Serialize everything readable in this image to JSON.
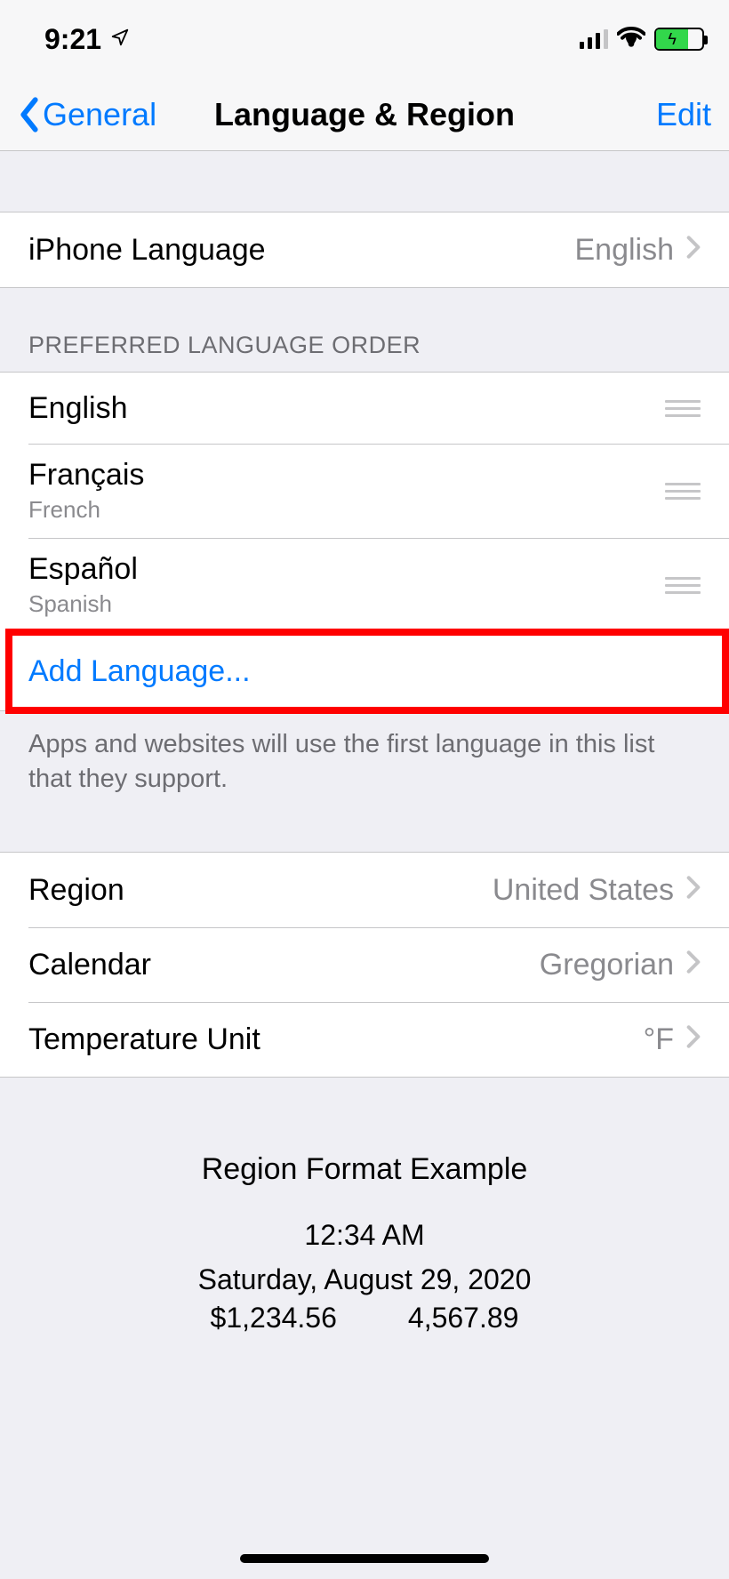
{
  "status": {
    "time": "9:21"
  },
  "nav": {
    "back_label": "General",
    "title": "Language & Region",
    "edit_label": "Edit"
  },
  "iphone_language": {
    "label": "iPhone Language",
    "value": "English"
  },
  "preferred_header": "PREFERRED LANGUAGE ORDER",
  "languages": [
    {
      "name": "English",
      "sub": ""
    },
    {
      "name": "Français",
      "sub": "French"
    },
    {
      "name": "Español",
      "sub": "Spanish"
    }
  ],
  "add_language_label": "Add Language...",
  "preferred_footer": "Apps and websites will use the first language in this list that they support.",
  "region_settings": {
    "region": {
      "label": "Region",
      "value": "United States"
    },
    "calendar": {
      "label": "Calendar",
      "value": "Gregorian"
    },
    "temperature": {
      "label": "Temperature Unit",
      "value": "°F"
    }
  },
  "example": {
    "title": "Region Format Example",
    "time": "12:34 AM",
    "date": "Saturday, August 29, 2020",
    "currency": "$1,234.56",
    "number": "4,567.89"
  }
}
